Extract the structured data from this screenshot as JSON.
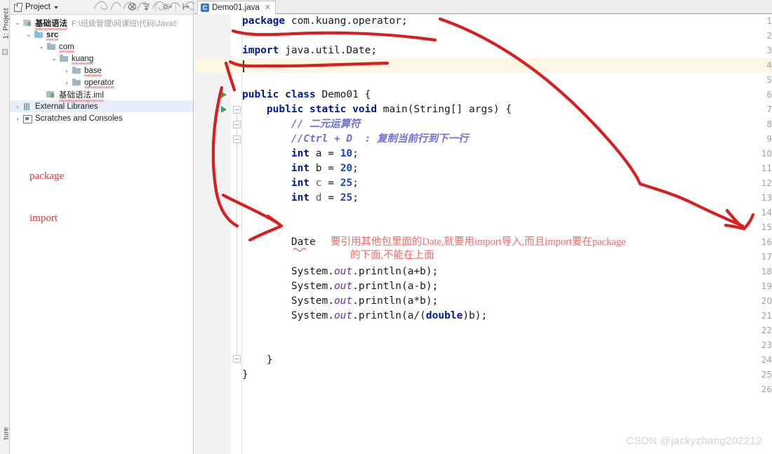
{
  "window": {
    "left_strip": {
      "top_tab": "1: Project",
      "bottom_tab": "ture",
      "icon": "project-tool-icon"
    }
  },
  "project_panel": {
    "toolbar": {
      "title": "Project",
      "dropdown_icon": "chevron-down-icon",
      "icons": [
        "collapse-all-icon",
        "expand-all-icon",
        "settings-gear-icon",
        "hide-panel-icon"
      ]
    },
    "tree": [
      {
        "label": "基础语法",
        "path": "F:\\班级管理\\网课班\\代码\\JavaSE\\基础",
        "twisty": "⌄",
        "icon": "module-icon",
        "depth": 0,
        "bold": true,
        "squiggly": true
      },
      {
        "label": "src",
        "path": "",
        "twisty": "⌄",
        "icon": "source-folder-icon",
        "depth": 1,
        "bold": true,
        "squiggly": true
      },
      {
        "label": "com",
        "path": "",
        "twisty": "⌄",
        "icon": "folder-icon",
        "depth": 2,
        "bold": false,
        "squiggly": true
      },
      {
        "label": "kuang",
        "path": "",
        "twisty": "⌄",
        "icon": "folder-icon",
        "depth": 3,
        "bold": false,
        "squiggly": true
      },
      {
        "label": "base",
        "path": "",
        "twisty": "›",
        "icon": "folder-icon",
        "depth": 4,
        "bold": false,
        "squiggly": true
      },
      {
        "label": "operator",
        "path": "",
        "twisty": "›",
        "icon": "folder-icon",
        "depth": 4,
        "bold": false,
        "squiggly": true
      },
      {
        "label": "基础语法.iml",
        "path": "",
        "twisty": "",
        "icon": "iml-file-icon",
        "depth": 2,
        "bold": false,
        "squiggly": true
      },
      {
        "label": "External Libraries",
        "path": "",
        "twisty": "›",
        "icon": "external-libraries-icon",
        "depth": 0,
        "bold": false,
        "squiggly": false,
        "selected": true
      },
      {
        "label": "Scratches and Consoles",
        "path": "",
        "twisty": "›",
        "icon": "scratches-icon",
        "depth": 0,
        "bold": false,
        "squiggly": false
      }
    ],
    "annotations": {
      "package_label": "package",
      "import_label": "import"
    }
  },
  "editor": {
    "tab": {
      "filename": "Demo01.java",
      "file_icon": "java-class-icon",
      "icon_letter": "C",
      "close_icon": "close-icon"
    },
    "caret_line": 4,
    "lines": [
      {
        "n": 1,
        "html": "<span class=\"kw\">package</span> com.kuang.operator;"
      },
      {
        "n": 2,
        "html": ""
      },
      {
        "n": 3,
        "html": "<span class=\"kw\">import</span> java.util.Date;"
      },
      {
        "n": 4,
        "html": ""
      },
      {
        "n": 5,
        "html": ""
      },
      {
        "n": 6,
        "html": "<span class=\"kw\">public class</span> Demo01 {"
      },
      {
        "n": 7,
        "html": "    <span class=\"kw\">public static void</span> main(String[] args) {"
      },
      {
        "n": 8,
        "html": "        <span class=\"cmt\">// 二元运算符</span>"
      },
      {
        "n": 9,
        "html": "        <span class=\"cmt\">//Ctrl + D  : 复制当前行到下一行</span>"
      },
      {
        "n": 10,
        "html": "        <span class=\"kw\">int</span> a = <span class=\"num\">10</span>;"
      },
      {
        "n": 11,
        "html": "        <span class=\"kw\">int</span> b = <span class=\"num\">20</span>;"
      },
      {
        "n": 12,
        "html": "        <span class=\"kw\">int</span> <span class=\"idg\">c</span> = <span class=\"num\">25</span>;"
      },
      {
        "n": 13,
        "html": "        <span class=\"kw\">int</span> <span class=\"idg\">d</span> = <span class=\"num\">25</span>;"
      },
      {
        "n": 14,
        "html": ""
      },
      {
        "n": 15,
        "html": ""
      },
      {
        "n": 16,
        "html": "        Date"
      },
      {
        "n": 17,
        "html": ""
      },
      {
        "n": 18,
        "html": "        System.<span class=\"stat\">out</span>.println(a+b);"
      },
      {
        "n": 19,
        "html": "        System.<span class=\"stat\">out</span>.println(a-b);"
      },
      {
        "n": 20,
        "html": "        System.<span class=\"stat\">out</span>.println(a*b);"
      },
      {
        "n": 21,
        "html": "        System.<span class=\"stat\">out</span>.println(a/(<span class=\"kw\">double</span>)b);"
      },
      {
        "n": 22,
        "html": ""
      },
      {
        "n": 23,
        "html": ""
      },
      {
        "n": 24,
        "html": "    }"
      },
      {
        "n": 25,
        "html": "}"
      },
      {
        "n": 26,
        "html": ""
      }
    ],
    "run_arrow_lines": [
      6,
      7
    ],
    "annotation_red": {
      "line1": "要引用其他包里面的Date,就要用import导入,而且import要在package",
      "line2": "的下面,不能在上面"
    }
  },
  "watermark": "CSDN @jackyzhang202212",
  "colors": {
    "keyword": "#00199e",
    "number": "#1a43c9",
    "comment": "#6f6fd6",
    "static_field": "#6b2fa0",
    "annotation_red": "#f06a6a",
    "note_red": "#d93a3a",
    "caret_line_bg": "#fdf6e3",
    "gutter_bg": "#f2f2f2",
    "selection_bg": "#e6effa"
  }
}
